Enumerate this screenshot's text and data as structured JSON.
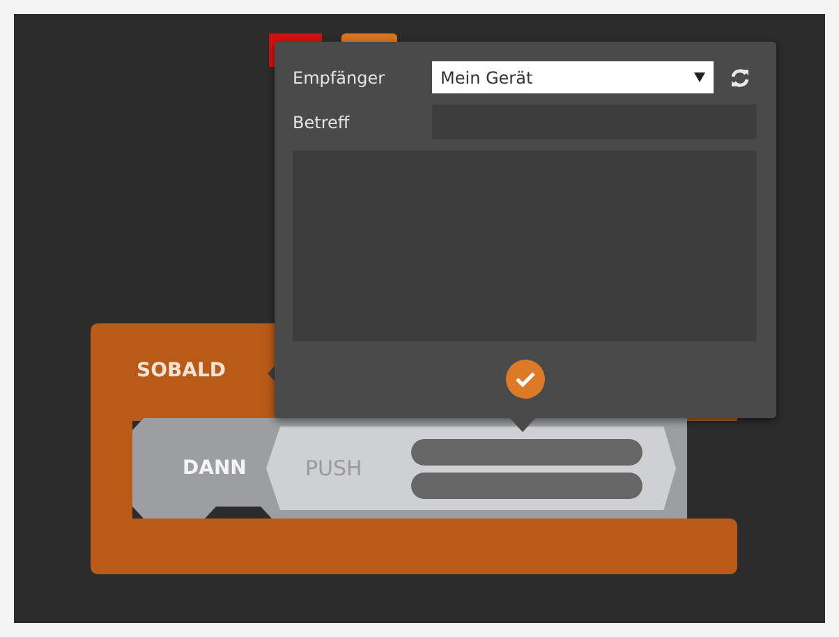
{
  "trigger_block": {
    "label": "SOBALD"
  },
  "action_block": {
    "label": "DANN",
    "action": "PUSH"
  },
  "popup": {
    "fields": [
      {
        "kind": "select",
        "label": "Empfänger",
        "value": "Mein Gerät"
      },
      {
        "kind": "text",
        "label": "Betreff"
      }
    ]
  }
}
